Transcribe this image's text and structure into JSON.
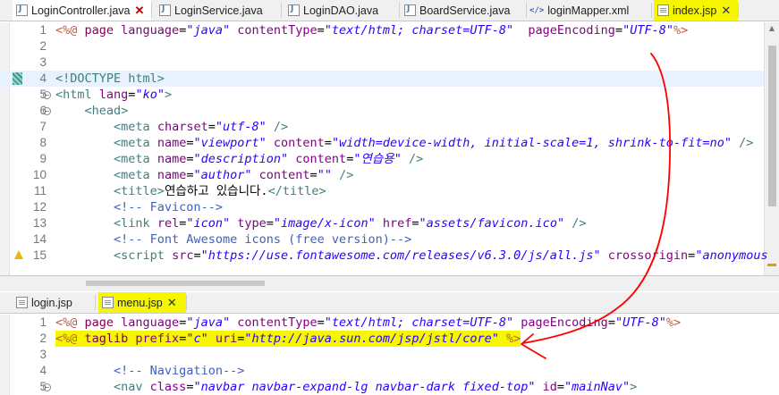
{
  "top_tabs": [
    {
      "label": "LoginController.java",
      "icon": "java-file-icon",
      "close": "✕",
      "active": true
    },
    {
      "label": "LoginService.java",
      "icon": "java-file-icon"
    },
    {
      "label": "LoginDAO.java",
      "icon": "java-file-icon"
    },
    {
      "label": "BoardService.java",
      "icon": "java-file-icon"
    },
    {
      "label": "loginMapper.xml",
      "icon": "xml-file-icon"
    },
    {
      "label": "index.jsp",
      "icon": "jsp-file-icon",
      "close": "✕",
      "highlighted": true
    }
  ],
  "top_editor": {
    "file": "index.jsp",
    "lines": [
      {
        "n": "1",
        "tokens": [
          [
            "jsp",
            "<%@ "
          ],
          [
            "kw",
            "page "
          ],
          [
            "attr",
            "language"
          ],
          [
            "txt",
            "="
          ],
          [
            "str",
            "\"java\""
          ],
          [
            "txt",
            " "
          ],
          [
            "attr",
            "contentType"
          ],
          [
            "txt",
            "="
          ],
          [
            "str",
            "\"text/html; charset=UTF-8\""
          ],
          [
            "txt",
            "  "
          ],
          [
            "attr",
            "pageEncoding"
          ],
          [
            "txt",
            "="
          ],
          [
            "str",
            "\"UTF-8\""
          ],
          [
            "jsp",
            "%>"
          ]
        ]
      },
      {
        "n": "2",
        "tokens": []
      },
      {
        "n": "3",
        "tokens": []
      },
      {
        "n": "4",
        "tokens": [
          [
            "tag",
            "<!DOCTYPE html>"
          ]
        ],
        "current": true,
        "bookmark": true
      },
      {
        "n": "5",
        "tokens": [
          [
            "tag",
            "<html "
          ],
          [
            "attr",
            "lang"
          ],
          [
            "txt",
            "="
          ],
          [
            "str",
            "\"ko\""
          ],
          [
            "tag",
            ">"
          ]
        ],
        "fold": true
      },
      {
        "n": "6",
        "tokens": [
          [
            "txt",
            "    "
          ],
          [
            "tag",
            "<head>"
          ]
        ],
        "fold": true
      },
      {
        "n": "7",
        "tokens": [
          [
            "txt",
            "        "
          ],
          [
            "tag",
            "<meta "
          ],
          [
            "attr",
            "charset"
          ],
          [
            "txt",
            "="
          ],
          [
            "str",
            "\"utf-8\""
          ],
          [
            "tag",
            " />"
          ]
        ]
      },
      {
        "n": "8",
        "tokens": [
          [
            "txt",
            "        "
          ],
          [
            "tag",
            "<meta "
          ],
          [
            "attr",
            "name"
          ],
          [
            "txt",
            "="
          ],
          [
            "str",
            "\"viewport\""
          ],
          [
            "txt",
            " "
          ],
          [
            "attr",
            "content"
          ],
          [
            "txt",
            "="
          ],
          [
            "str",
            "\"width=device-width, initial-scale=1, shrink-to-fit=no\""
          ],
          [
            "tag",
            " />"
          ]
        ]
      },
      {
        "n": "9",
        "tokens": [
          [
            "txt",
            "        "
          ],
          [
            "tag",
            "<meta "
          ],
          [
            "attr",
            "name"
          ],
          [
            "txt",
            "="
          ],
          [
            "str",
            "\"description\""
          ],
          [
            "txt",
            " "
          ],
          [
            "attr",
            "content"
          ],
          [
            "txt",
            "="
          ],
          [
            "str",
            "\"연습용\""
          ],
          [
            "tag",
            " />"
          ]
        ]
      },
      {
        "n": "10",
        "tokens": [
          [
            "txt",
            "        "
          ],
          [
            "tag",
            "<meta "
          ],
          [
            "attr",
            "name"
          ],
          [
            "txt",
            "="
          ],
          [
            "str",
            "\"author\""
          ],
          [
            "txt",
            " "
          ],
          [
            "attr",
            "content"
          ],
          [
            "txt",
            "="
          ],
          [
            "str",
            "\"\""
          ],
          [
            "tag",
            " />"
          ]
        ]
      },
      {
        "n": "11",
        "tokens": [
          [
            "txt",
            "        "
          ],
          [
            "tag",
            "<title>"
          ],
          [
            "txt",
            "연습하고 있습니다."
          ],
          [
            "tag",
            "</title>"
          ]
        ]
      },
      {
        "n": "12",
        "tokens": [
          [
            "txt",
            "        "
          ],
          [
            "cmt",
            "<!-- Favicon-->"
          ]
        ]
      },
      {
        "n": "13",
        "tokens": [
          [
            "txt",
            "        "
          ],
          [
            "tag",
            "<link "
          ],
          [
            "attr",
            "rel"
          ],
          [
            "txt",
            "="
          ],
          [
            "str",
            "\"icon\""
          ],
          [
            "txt",
            " "
          ],
          [
            "attr",
            "type"
          ],
          [
            "txt",
            "="
          ],
          [
            "str",
            "\"image/x-icon\""
          ],
          [
            "txt",
            " "
          ],
          [
            "attr",
            "href"
          ],
          [
            "txt",
            "="
          ],
          [
            "str",
            "\"assets/favicon.ico\""
          ],
          [
            "tag",
            " />"
          ]
        ]
      },
      {
        "n": "14",
        "tokens": [
          [
            "txt",
            "        "
          ],
          [
            "cmt",
            "<!-- Font Awesome icons (free version)-->"
          ]
        ]
      },
      {
        "n": "15",
        "tokens": [
          [
            "txt",
            "        "
          ],
          [
            "tag",
            "<script "
          ],
          [
            "attr",
            "src"
          ],
          [
            "txt",
            "="
          ],
          [
            "str",
            "\"https://use.fontawesome.com/releases/v6.3.0/js/all.js\""
          ],
          [
            "txt",
            " "
          ],
          [
            "attr",
            "crossorigin"
          ],
          [
            "txt",
            "="
          ],
          [
            "str",
            "\"anonymous"
          ]
        ],
        "warning": true
      }
    ]
  },
  "bottom_tabs": [
    {
      "label": "login.jsp",
      "icon": "jsp-file-icon"
    },
    {
      "label": "menu.jsp",
      "icon": "jsp-file-icon",
      "close": "✕",
      "active": true,
      "highlighted": true
    }
  ],
  "bottom_editor": {
    "file": "menu.jsp",
    "lines": [
      {
        "n": "1",
        "tokens": [
          [
            "jsp",
            "<%@ "
          ],
          [
            "kw",
            "page "
          ],
          [
            "attr",
            "language"
          ],
          [
            "txt",
            "="
          ],
          [
            "str",
            "\"java\""
          ],
          [
            "txt",
            " "
          ],
          [
            "attr",
            "contentType"
          ],
          [
            "txt",
            "="
          ],
          [
            "str",
            "\"text/html; charset=UTF-8\""
          ],
          [
            "txt",
            " "
          ],
          [
            "attr",
            "pageEncoding"
          ],
          [
            "txt",
            "="
          ],
          [
            "str",
            "\"UTF-8\""
          ],
          [
            "jsp",
            "%>"
          ]
        ]
      },
      {
        "n": "2",
        "tokens": [
          [
            "jsp",
            "<%@ "
          ],
          [
            "kw",
            "taglib "
          ],
          [
            "attr",
            "prefix"
          ],
          [
            "txt",
            "="
          ],
          [
            "str",
            "\"c\""
          ],
          [
            "txt",
            " "
          ],
          [
            "attr",
            "uri"
          ],
          [
            "txt",
            "="
          ],
          [
            "str",
            "\"http://java.sun.com/jsp/jstl/core\""
          ],
          [
            "txt",
            " "
          ],
          [
            "jsp",
            "%>"
          ]
        ],
        "highlighted": true
      },
      {
        "n": "3",
        "tokens": []
      },
      {
        "n": "4",
        "tokens": [
          [
            "txt",
            "        "
          ],
          [
            "cmt",
            "<!-- Navigation-->"
          ]
        ]
      },
      {
        "n": "5",
        "tokens": [
          [
            "txt",
            "        "
          ],
          [
            "tag",
            "<nav "
          ],
          [
            "attr",
            "class"
          ],
          [
            "txt",
            "="
          ],
          [
            "str",
            "\"navbar navbar-expand-lg navbar-dark fixed-top\""
          ],
          [
            "txt",
            " "
          ],
          [
            "attr",
            "id"
          ],
          [
            "txt",
            "="
          ],
          [
            "str",
            "\"mainNav\""
          ],
          [
            "tag",
            ">"
          ]
        ],
        "fold": true
      }
    ]
  },
  "colors": {
    "highlight": "#f6f600",
    "annotation_arrow": "#ff0000"
  }
}
